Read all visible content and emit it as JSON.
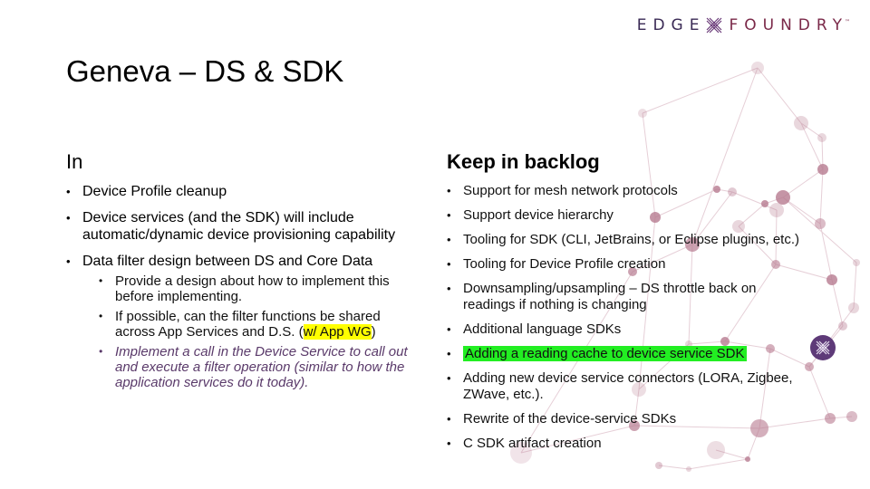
{
  "logo": {
    "left_text": "EDGE",
    "right_text": "FOUNDRY",
    "trademark": "™",
    "icon": "x-logo-icon"
  },
  "title": "Geneva – DS & SDK",
  "left_column": {
    "heading": "In",
    "items": [
      {
        "text": "Device Profile cleanup"
      },
      {
        "text": "Device services (and the SDK) will include automatic/dynamic device provisioning capability"
      },
      {
        "text": "Data filter design between DS and Core Data",
        "subitems": [
          {
            "text": "Provide a design about how to implement this before implementing."
          },
          {
            "text_before": "If possible, can the filter functions be shared across App Services and D.S. (",
            "highlight": "w/ App WG",
            "text_after": ")"
          },
          {
            "text": "Implement a call in the Device Service to call out and execute a filter operation (similar to how the application services do it today)."
          }
        ]
      }
    ]
  },
  "right_column": {
    "heading": "Keep in backlog",
    "items": [
      {
        "text": "Support for mesh network protocols"
      },
      {
        "text": "Support device hierarchy"
      },
      {
        "text": "Tooling for SDK (CLI, JetBrains, or Eclipse plugins, etc.)"
      },
      {
        "text": "Tooling for Device Profile creation"
      },
      {
        "text": "Downsampling/upsampling – DS throttle back on readings if nothing is changing"
      },
      {
        "text": "Additional language SDKs"
      },
      {
        "text": "Adding a reading cache to device service SDK",
        "highlight_color": "#22ee22"
      },
      {
        "text": "Adding new device service connectors (LORA, Zigbee, ZWave, etc.)."
      },
      {
        "text": "Rewrite of the device-service SDKs"
      },
      {
        "text": "C SDK artifact creation"
      }
    ]
  },
  "colors": {
    "accent_purple": "#5e3a78",
    "accent_maroon": "#7a2848",
    "node_pink": "#c08a9c",
    "highlight_yellow": "#ffff00",
    "highlight_green": "#22ee22"
  }
}
